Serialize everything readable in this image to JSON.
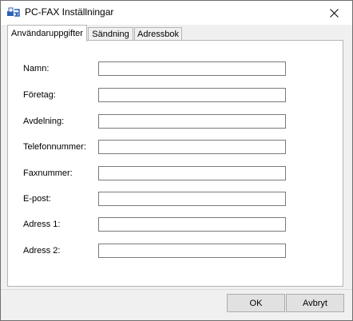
{
  "window": {
    "title": "PC-FAX Inställningar",
    "app_icon": "pc-fax-icon",
    "close_icon": "close-icon"
  },
  "tabs": [
    {
      "label": "Användaruppgifter",
      "active": true
    },
    {
      "label": "Sändning",
      "active": false
    },
    {
      "label": "Adressbok",
      "active": false
    }
  ],
  "fields": [
    {
      "label": "Namn:",
      "value": ""
    },
    {
      "label": "Företag:",
      "value": ""
    },
    {
      "label": "Avdelning:",
      "value": ""
    },
    {
      "label": "Telefonnummer:",
      "value": ""
    },
    {
      "label": "Faxnummer:",
      "value": ""
    },
    {
      "label": "E-post:",
      "value": ""
    },
    {
      "label": "Adress 1:",
      "value": ""
    },
    {
      "label": "Adress 2:",
      "value": ""
    }
  ],
  "buttons": {
    "ok": "OK",
    "cancel": "Avbryt"
  },
  "colors": {
    "window_bg": "#f0f0f0",
    "panel_bg": "#ffffff",
    "border": "#b5b5b5",
    "button_bg": "#e1e1e1"
  }
}
